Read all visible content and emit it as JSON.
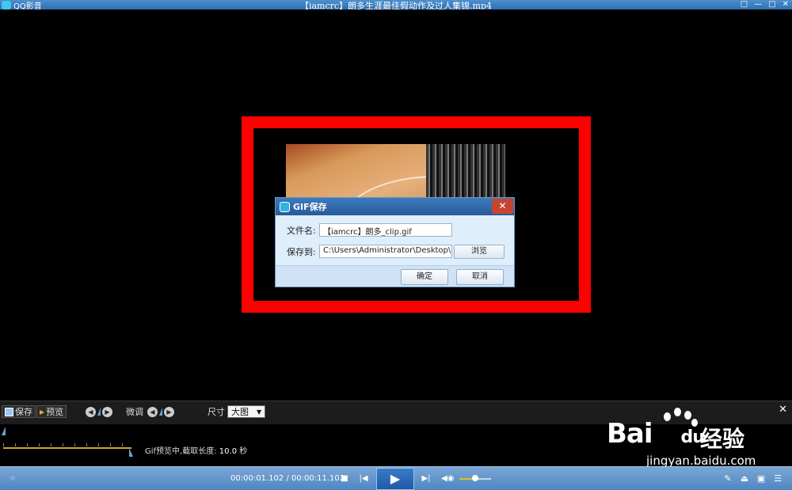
{
  "window": {
    "app_name": "QQ影音",
    "file_title": "【iamcrc】朗多生涯最佳假动作及过人集锦.mp4",
    "controls": [
      "□",
      "—",
      "□",
      "✕"
    ]
  },
  "dialog": {
    "title": "GIF保存",
    "filename_label": "文件名:",
    "filename_value": "【iamcrc】朗多_clip.gif",
    "saveto_label": "保存到:",
    "saveto_value": "C:\\Users\\Administrator\\Desktop\\",
    "browse_label": "浏览",
    "ok_label": "确定",
    "cancel_label": "取消",
    "close_icon": "✕"
  },
  "gif_toolbar": {
    "save_label": "保存",
    "preview_label": "预览",
    "finetune_label": "微调",
    "size_label": "尺寸",
    "size_value": "大图"
  },
  "gif_status": {
    "prefix": "Gif预览中,截取长度:",
    "length": "10.0",
    "unit": "秒"
  },
  "player": {
    "time": "00:00:01.102 / 00:00:11.102",
    "volume_level": 0.5
  },
  "watermark": {
    "brand": "Bai",
    "brand_suffix": "du",
    "cn": "经验",
    "url": "jingyan.baidu.com"
  }
}
